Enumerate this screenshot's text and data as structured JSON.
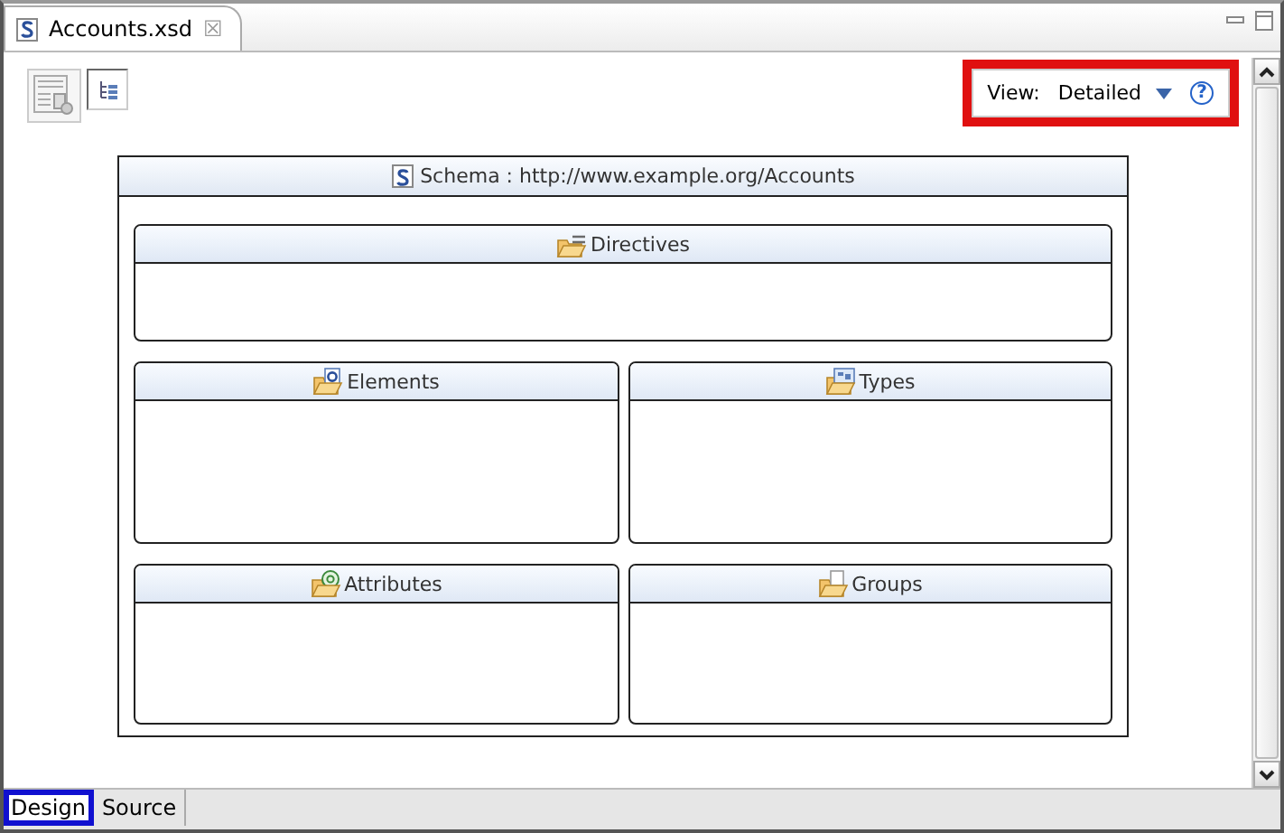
{
  "editor_tab": {
    "title": "Accounts.xsd",
    "close": "☒"
  },
  "view": {
    "label": "View:",
    "value": "Detailed",
    "help": "?",
    "highlighted": true
  },
  "schema": {
    "title": "Schema : http://www.example.org/Accounts"
  },
  "compartments": [
    {
      "title": "Directives",
      "kind": "directives"
    },
    {
      "title": "Elements",
      "kind": "elements"
    },
    {
      "title": "Types",
      "kind": "types"
    },
    {
      "title": "Attributes",
      "kind": "attributes"
    },
    {
      "title": "Groups",
      "kind": "groups"
    }
  ],
  "bottom_tabs": [
    {
      "label": "Design",
      "selected": true,
      "highlighted": true
    },
    {
      "label": "Source",
      "selected": false,
      "highlighted": false
    }
  ]
}
